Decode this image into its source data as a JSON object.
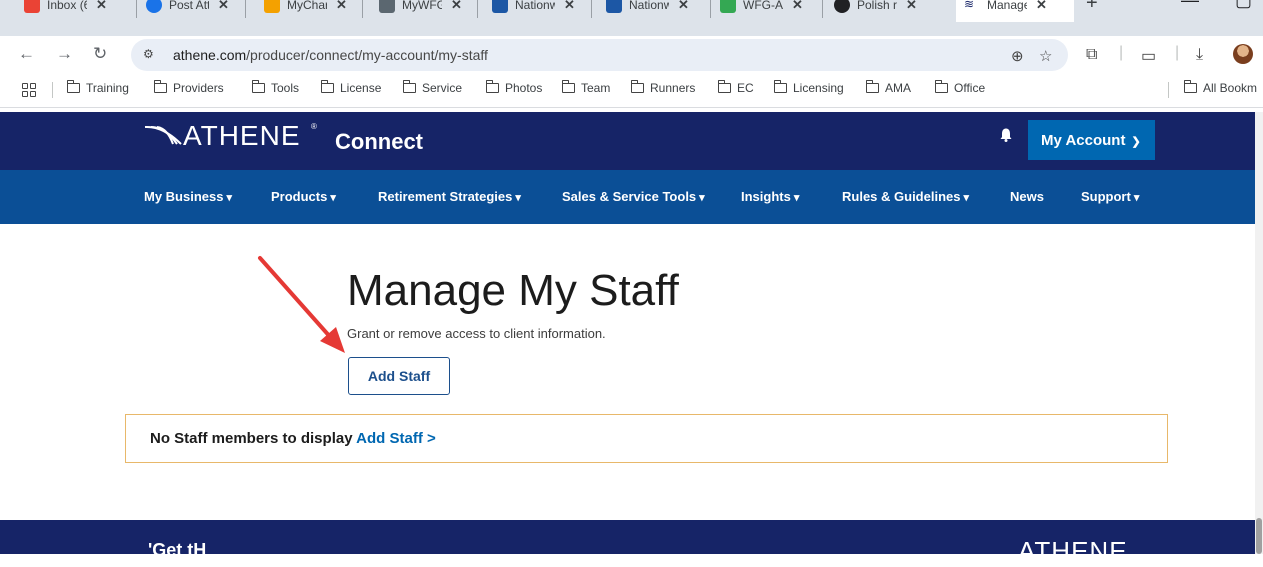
{
  "browser": {
    "tabs": [
      {
        "title": "Inbox (6",
        "color": "#ea4335"
      },
      {
        "title": "Post Atte",
        "color": "#1a73e8"
      },
      {
        "title": "MyChart",
        "color": "#f4a100"
      },
      {
        "title": "MyWFG",
        "color": "#5b6770"
      },
      {
        "title": "Nationw",
        "color": "#1c57a5"
      },
      {
        "title": "Nationw",
        "color": "#1c57a5"
      },
      {
        "title": "WFG-AN",
        "color": "#34a853"
      },
      {
        "title": "Polish re",
        "color": "#202124"
      },
      {
        "title": "Manage",
        "color": "#162467"
      }
    ],
    "url_domain": "athene.com",
    "url_path": "/producer/connect/my-account/my-staff"
  },
  "bookmarks": [
    "Training",
    "Providers",
    "Tools",
    "License",
    "Service",
    "Photos",
    "Team",
    "Runners",
    "EC",
    "Licensing",
    "AMA",
    "Office"
  ],
  "bookmarks_right": "All Bookm",
  "header": {
    "logo": "ATHENE",
    "logo_reg": "®",
    "product": "Connect",
    "account_label": "My Account"
  },
  "nav": [
    {
      "label": "My Business",
      "chevron": true
    },
    {
      "label": "Products",
      "chevron": true
    },
    {
      "label": "Retirement Strategies",
      "chevron": true
    },
    {
      "label": "Sales & Service Tools",
      "chevron": true
    },
    {
      "label": "Insights",
      "chevron": true
    },
    {
      "label": "Rules & Guidelines",
      "chevron": true
    },
    {
      "label": "News",
      "chevron": false
    },
    {
      "label": "Support",
      "chevron": true
    }
  ],
  "main": {
    "title": "Manage My Staff",
    "subtitle": "Grant or remove access to client information.",
    "add_staff_label": "Add Staff",
    "empty_text": "No Staff members to display",
    "empty_link": "Add Staff >"
  },
  "footer": {
    "left_text": "'Get tH",
    "logo": "ATHENE"
  },
  "colors": {
    "header_bg": "#162467",
    "nav_bg": "#0b4f96",
    "accent": "#0067b1",
    "annotation_arrow": "#e53935",
    "empty_border": "#e8b86a"
  }
}
